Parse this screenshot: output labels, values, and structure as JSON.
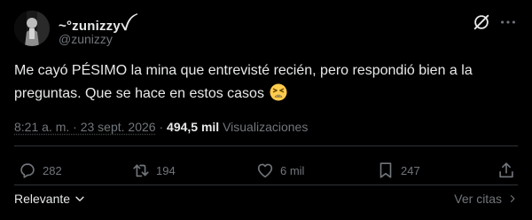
{
  "author": {
    "display_name": "~°zunizzyꪜ",
    "handle": "@zunizzy"
  },
  "tweet": {
    "text": "Me cayó PÉSIMO la mina que entrevisté recién, pero respondió bien a la preguntas. Que se hace en estos casos",
    "emoji": "tired-face"
  },
  "meta": {
    "time": "8:21 a. m.",
    "separator": "·",
    "date": "23 sept. 2026",
    "separator2": "·",
    "views_count": "494,5 mil",
    "views_label": "Visualizaciones"
  },
  "actions": {
    "replies": "282",
    "reposts": "194",
    "likes": "6 mil",
    "bookmarks": "247"
  },
  "footer": {
    "sort_label": "Relevante",
    "quotes_label": "Ver citas"
  },
  "colors": {
    "background": "#000000",
    "text_primary": "#e7e9ea",
    "text_secondary": "#71767b",
    "divider": "#2f3336"
  }
}
